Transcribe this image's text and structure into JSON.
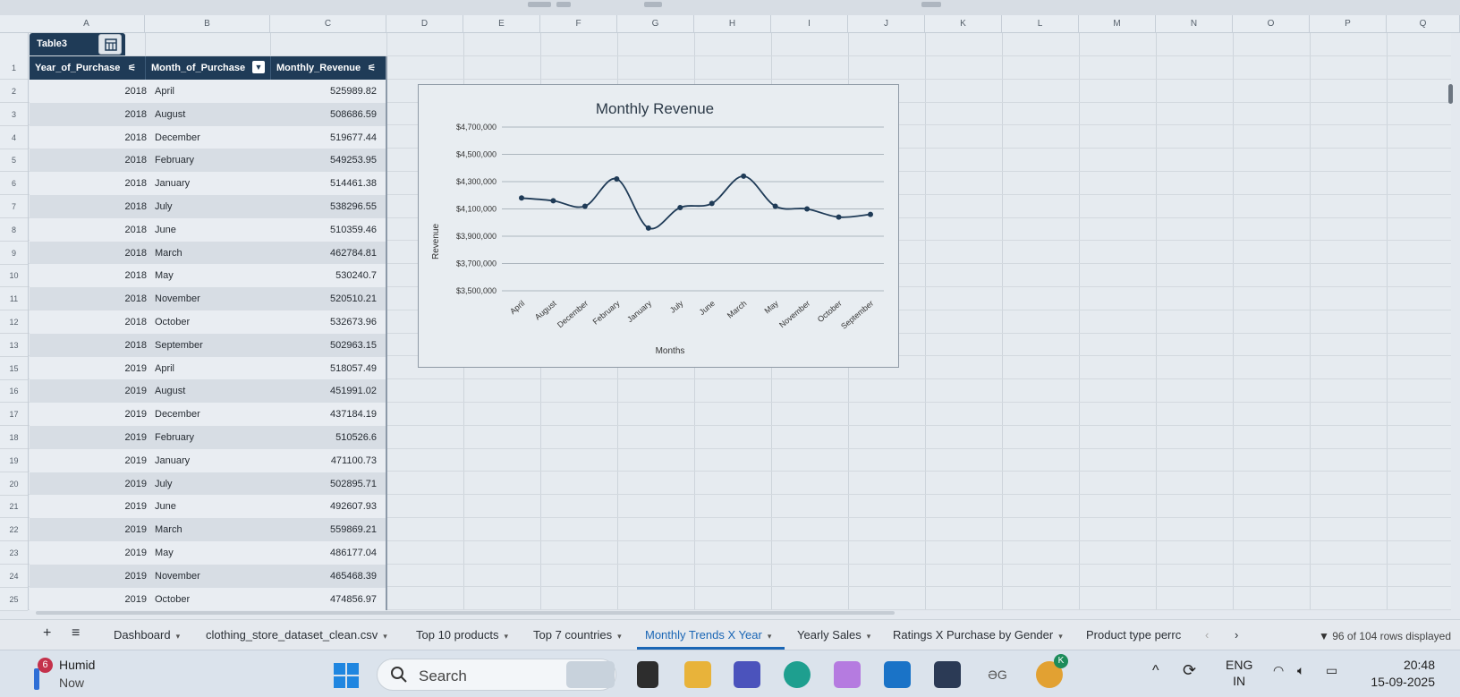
{
  "spreadsheet": {
    "columns": [
      "A",
      "B",
      "C",
      "D",
      "E",
      "F",
      "G",
      "H",
      "I",
      "J",
      "K",
      "L",
      "M",
      "N",
      "O",
      "P",
      "Q"
    ],
    "table_name": "Table3",
    "headers": [
      "Year_of_Purchase",
      "Month_of_Purchase",
      "Monthly_Revenue"
    ],
    "row_numbers": [
      "1",
      "2",
      "3",
      "4",
      "5",
      "6",
      "7",
      "8",
      "9",
      "10",
      "11",
      "12",
      "13",
      "15",
      "16",
      "17",
      "18",
      "19",
      "20",
      "21",
      "22",
      "23",
      "24",
      "25"
    ],
    "rows": [
      {
        "year": "2018",
        "month": "April",
        "revenue": "525989.82"
      },
      {
        "year": "2018",
        "month": "August",
        "revenue": "508686.59"
      },
      {
        "year": "2018",
        "month": "December",
        "revenue": "519677.44"
      },
      {
        "year": "2018",
        "month": "February",
        "revenue": "549253.95"
      },
      {
        "year": "2018",
        "month": "January",
        "revenue": "514461.38"
      },
      {
        "year": "2018",
        "month": "July",
        "revenue": "538296.55"
      },
      {
        "year": "2018",
        "month": "June",
        "revenue": "510359.46"
      },
      {
        "year": "2018",
        "month": "March",
        "revenue": "462784.81"
      },
      {
        "year": "2018",
        "month": "May",
        "revenue": "530240.7"
      },
      {
        "year": "2018",
        "month": "November",
        "revenue": "520510.21"
      },
      {
        "year": "2018",
        "month": "October",
        "revenue": "532673.96"
      },
      {
        "year": "2018",
        "month": "September",
        "revenue": "502963.15"
      },
      {
        "year": "2019",
        "month": "April",
        "revenue": "518057.49"
      },
      {
        "year": "2019",
        "month": "August",
        "revenue": "451991.02"
      },
      {
        "year": "2019",
        "month": "December",
        "revenue": "437184.19"
      },
      {
        "year": "2019",
        "month": "February",
        "revenue": "510526.6"
      },
      {
        "year": "2019",
        "month": "January",
        "revenue": "471100.73"
      },
      {
        "year": "2019",
        "month": "July",
        "revenue": "502895.71"
      },
      {
        "year": "2019",
        "month": "June",
        "revenue": "492607.93"
      },
      {
        "year": "2019",
        "month": "March",
        "revenue": "559869.21"
      },
      {
        "year": "2019",
        "month": "May",
        "revenue": "486177.04"
      },
      {
        "year": "2019",
        "month": "November",
        "revenue": "465468.39"
      },
      {
        "year": "2019",
        "month": "October",
        "revenue": "474856.97"
      }
    ]
  },
  "chart_data": {
    "type": "line",
    "title": "Monthly Revenue",
    "xlabel": "Months",
    "ylabel": "Revenue",
    "categories": [
      "April",
      "August",
      "December",
      "February",
      "January",
      "July",
      "June",
      "March",
      "May",
      "November",
      "October",
      "September"
    ],
    "values": [
      4180000,
      4160000,
      4120000,
      4320000,
      3960000,
      4110000,
      4140000,
      4340000,
      4120000,
      4100000,
      4040000,
      4060000
    ],
    "ylim": [
      3500000,
      4700000
    ],
    "yticks": [
      3500000,
      3700000,
      3900000,
      4100000,
      4300000,
      4500000,
      4700000
    ],
    "ytick_labels": [
      "$3,500,000",
      "$3,700,000",
      "$3,900,000",
      "$4,100,000",
      "$4,300,000",
      "$4,500,000",
      "$4,700,000"
    ],
    "grid": true,
    "smooth": true,
    "color": "#1f3b57"
  },
  "sheet_tabs": {
    "add_label": "+",
    "menu_label": "≡",
    "tabs": [
      "Dashboard",
      "clothing_store_dataset_clean.csv",
      "Top 10 products",
      "Top 7 countries",
      "Monthly Trends X Year",
      "Yearly Sales",
      "Ratings X Purchase by Gender",
      "Product type perrc"
    ],
    "active_tab": "Monthly Trends X Year",
    "prev": "‹",
    "next": "›",
    "rows_displayed": "96 of 104 rows displayed"
  },
  "taskbar": {
    "weather_badge": "6",
    "weather_title": "Humid",
    "weather_sub": "Now",
    "search_placeholder": "Search",
    "language": "ENG",
    "region": "IN",
    "time": "20:48",
    "date": "15-09-2025",
    "copilot_badge": "K"
  }
}
